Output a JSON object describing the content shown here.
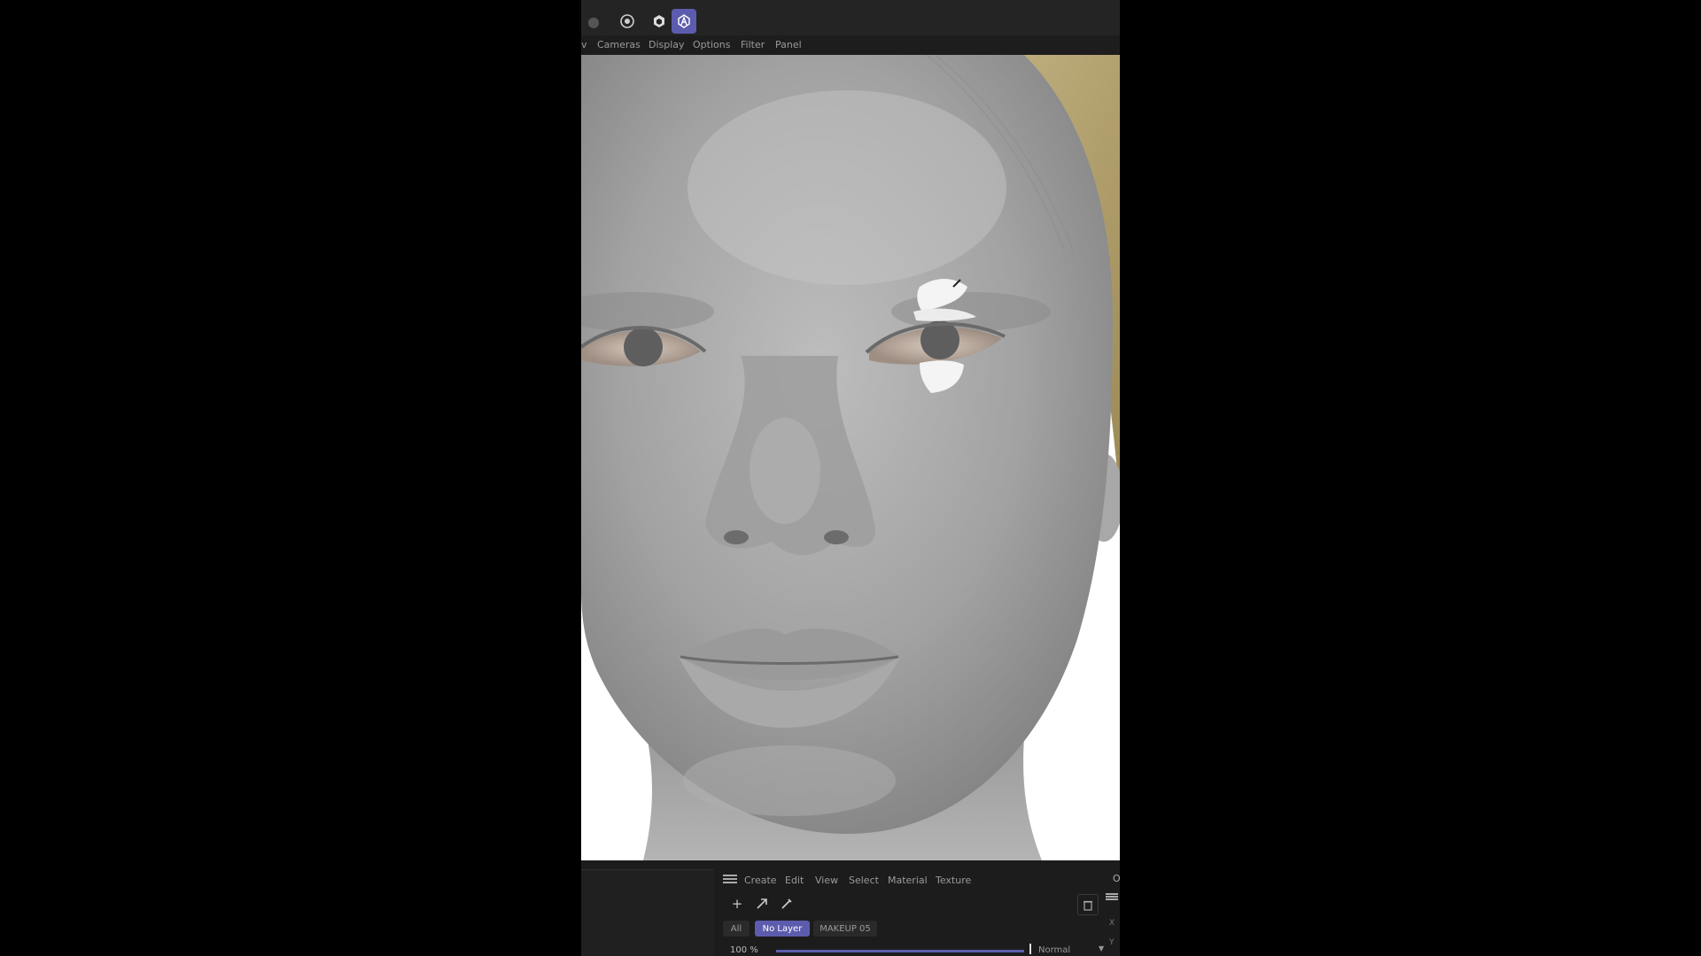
{
  "menubar": {
    "items": [
      "Cameras",
      "Display",
      "Options",
      "Filter",
      "Panel"
    ],
    "clipped_item": "v"
  },
  "toolbar": {
    "icons": [
      "render-settings-icon",
      "target-icon",
      "display-mode-icon",
      "paint-brush-mode-icon"
    ],
    "active_icon": "paint-brush-mode-icon"
  },
  "viewport": {
    "content": "3d-head-model"
  },
  "panel": {
    "menu": [
      "Create",
      "Edit",
      "View",
      "Select",
      "Material",
      "Texture"
    ],
    "tools": [
      "add-icon",
      "move-icon",
      "brush-icon"
    ],
    "layers": {
      "all": "All",
      "no_layer": "No Layer",
      "makeup": "MAKEUP 05"
    },
    "opacity": "100 %",
    "opacity_value": 1.0,
    "blend_mode": "Normal",
    "side_axes": [
      "X",
      "Y"
    ]
  },
  "colors": {
    "accent": "#5c5cae",
    "background": "#000000",
    "panel": "#1c1c1c"
  }
}
